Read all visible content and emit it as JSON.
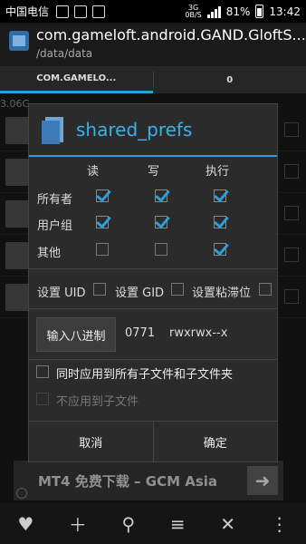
{
  "status_bar": {
    "carrier": "中国电信",
    "network": "3G",
    "speed": "0B/S",
    "battery": "81%",
    "time": "13:42"
  },
  "app": {
    "title": "com.gameloft.android.GAND.GloftS...",
    "subtitle": "/data/data",
    "tabs": [
      "COM.GAMELO...",
      "0"
    ],
    "path_hint": "3.06G"
  },
  "dialog": {
    "title": "shared_prefs",
    "columns": [
      "读",
      "写",
      "执行"
    ],
    "rows": [
      {
        "label": "所有者",
        "values": [
          true,
          true,
          true
        ]
      },
      {
        "label": "用户组",
        "values": [
          true,
          true,
          true
        ]
      },
      {
        "label": "其他",
        "values": [
          false,
          false,
          true
        ]
      }
    ],
    "special": [
      {
        "label": "设置 UID",
        "checked": false
      },
      {
        "label": "设置 GID",
        "checked": false
      },
      {
        "label": "设置粘滞位",
        "checked": false
      }
    ],
    "octal_button": "输入八进制",
    "octal_value": "0771",
    "perm_string": "rwxrwx--x",
    "apply_all": {
      "label": "同时应用到所有子文件和子文件夹",
      "checked": false
    },
    "no_apply_children": {
      "label": "不应用到子文件",
      "checked": false,
      "enabled": false
    },
    "cancel": "取消",
    "confirm": "确定"
  },
  "ad": {
    "text": "MT4 免费下载 – GCM Asia",
    "button": "➜"
  },
  "bottom_bar": {
    "icons": [
      "favorite-icon",
      "add-icon",
      "search-icon",
      "sort-icon",
      "close-icon",
      "more-icon"
    ]
  },
  "colors": {
    "accent": "#2a9fd8",
    "title": "#3ab2e8"
  }
}
